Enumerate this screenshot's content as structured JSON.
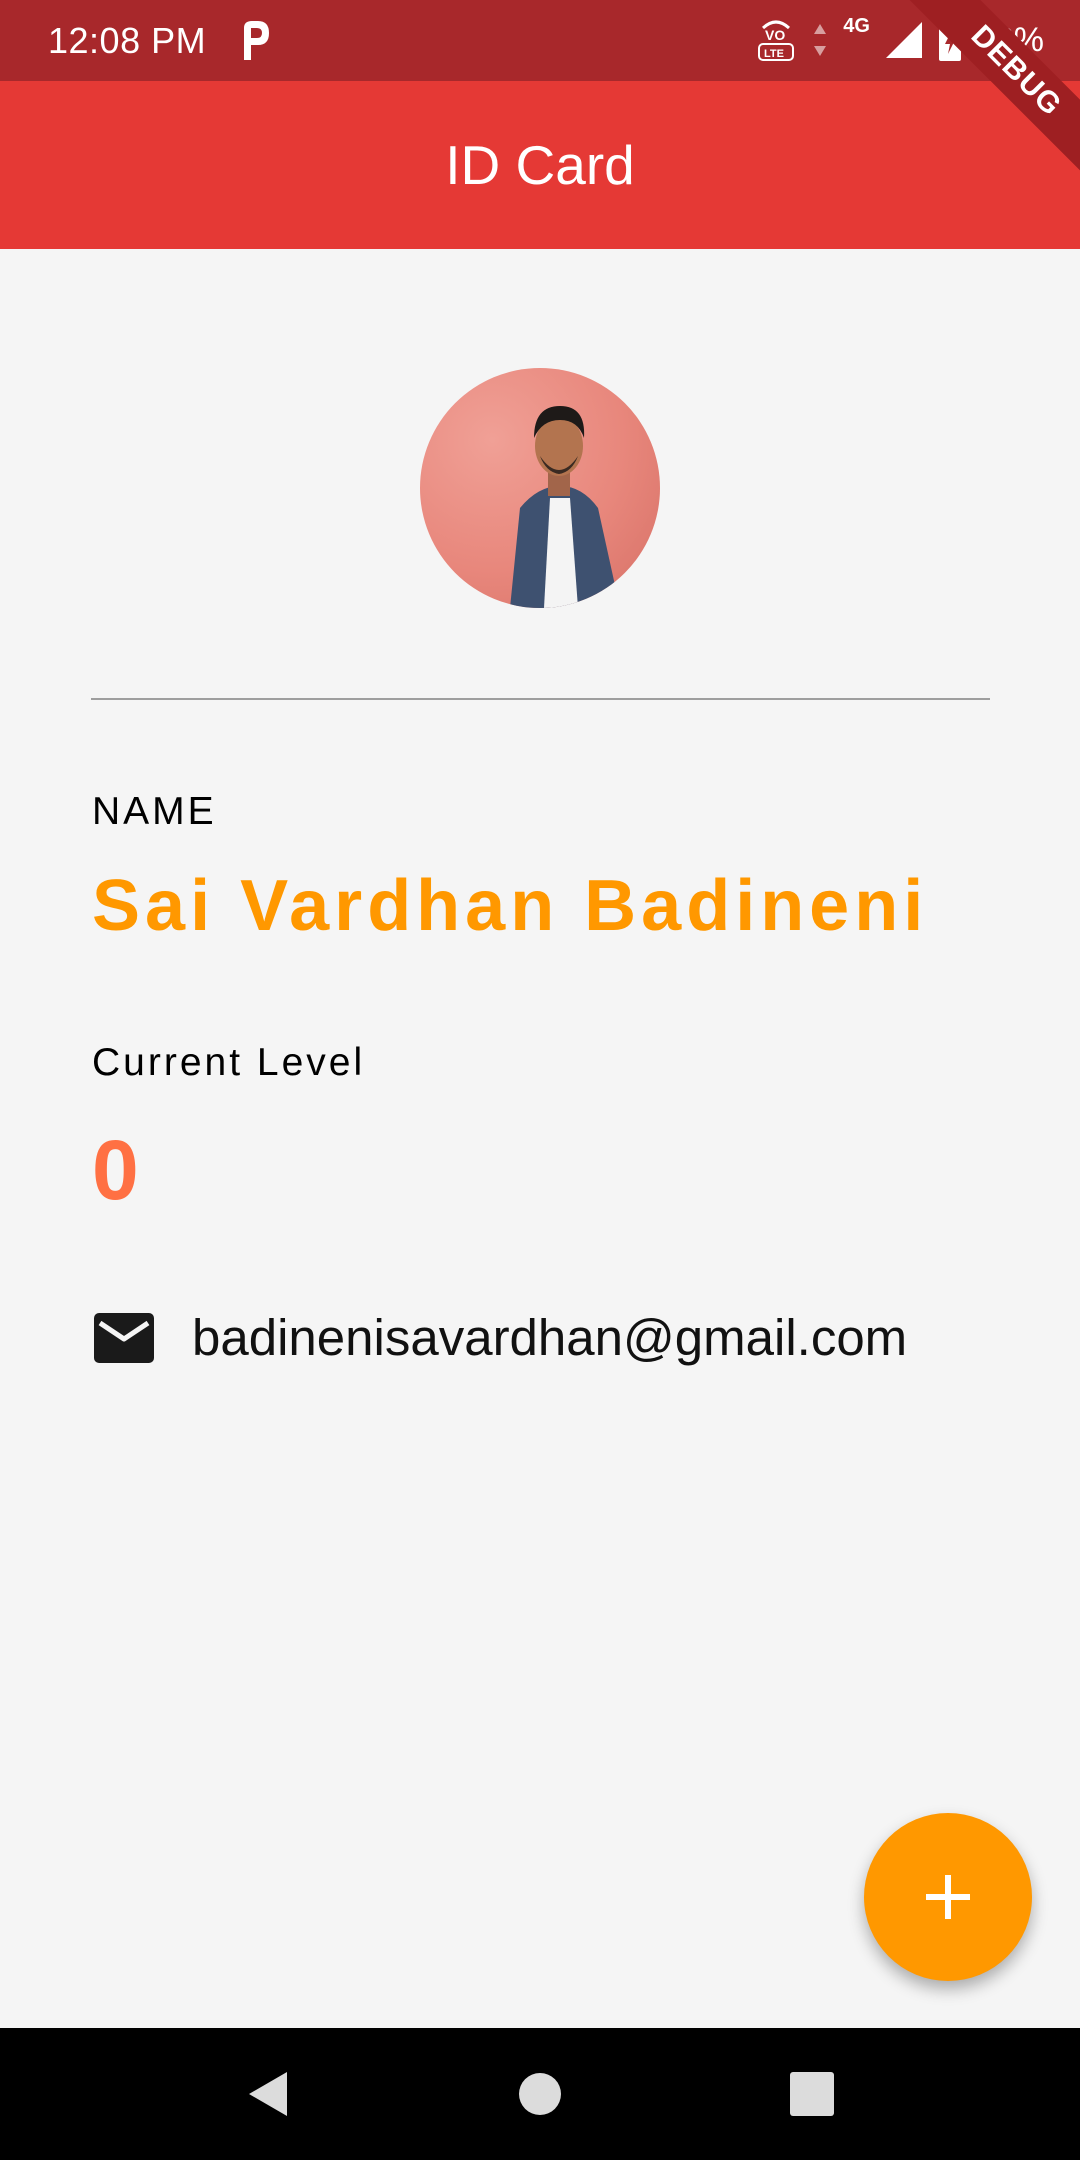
{
  "status_bar": {
    "time": "12:08 PM",
    "network": "4G",
    "battery": "53%"
  },
  "app_bar": {
    "title": "ID Card"
  },
  "debug_banner": "DEBUG",
  "profile": {
    "name_label": "NAME",
    "name": "Sai Vardhan Badineni",
    "level_label": "Current Level",
    "level": "0",
    "email": "badinenisavardhan@gmail.com"
  },
  "colors": {
    "app_bar": "#e53935",
    "status_bar": "#a8282b",
    "name": "#ff9800",
    "level": "#ff7043",
    "fab": "#ff9800",
    "background": "#f5f5f5"
  },
  "icons": {
    "email": "mail-icon",
    "fab": "plus-icon",
    "nav_back": "back-icon",
    "nav_home": "home-icon",
    "nav_recents": "recents-icon"
  }
}
